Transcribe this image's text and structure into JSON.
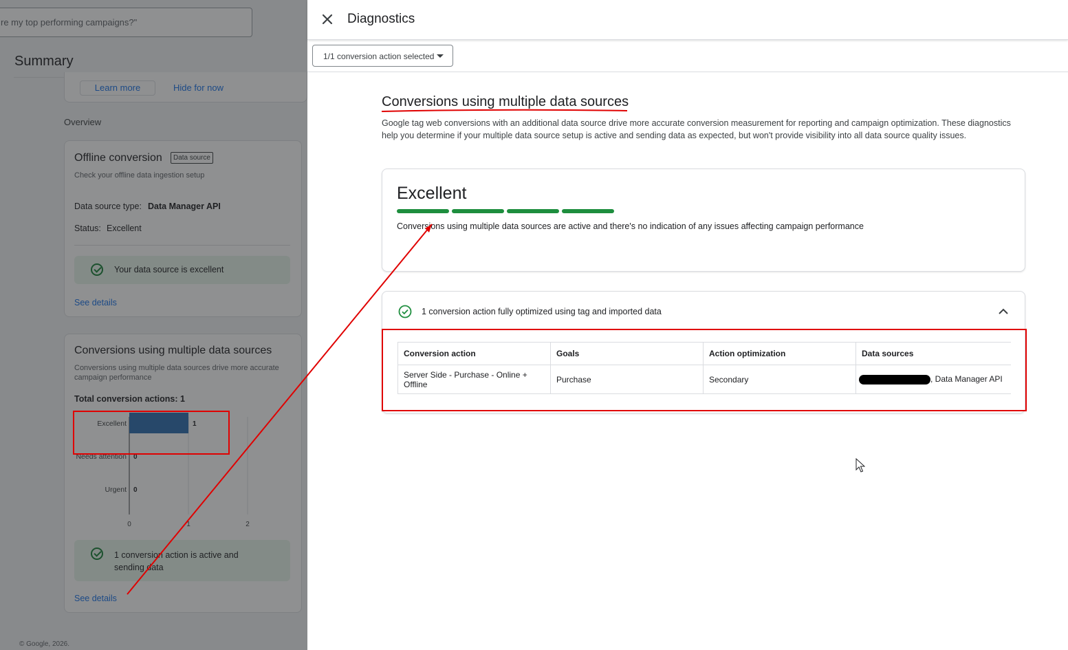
{
  "background": {
    "search_placeholder": "re my top performing campaigns?\"",
    "summary_title": "Summary",
    "learn_more": "Learn more",
    "hide_for_now": "Hide for now",
    "overview_label": "Overview",
    "offline_card": {
      "title": "Offline conversion",
      "chip": "Data source",
      "subtitle": "Check your offline data ingestion setup",
      "type_label": "Data source type:",
      "type_value": "Data Manager API",
      "status_label": "Status:",
      "status_value": "Excellent",
      "banner": "Your data source is excellent",
      "see_details": "See details"
    },
    "multi_card": {
      "title": "Conversions using multiple data sources",
      "subtitle": "Conversions using multiple data sources drive more accurate campaign performance",
      "total_label": "Total conversion actions: 1",
      "banner": "1 conversion action is active and sending data",
      "see_details": "See details"
    },
    "footer": "© Google, 2026."
  },
  "chart_data": {
    "type": "bar",
    "orientation": "horizontal",
    "categories": [
      "Excellent",
      "Needs attention",
      "Urgent"
    ],
    "values": [
      1,
      0,
      0
    ],
    "xticks": [
      "0",
      "1",
      "2"
    ],
    "xlim": [
      0,
      2
    ],
    "bar_color": "#2f6eb0"
  },
  "panel": {
    "title": "Diagnostics",
    "filter_label": "1/1 conversion action selected",
    "section_title": "Conversions using multiple data sources",
    "section_description": "Google tag web conversions with an additional data source drive more accurate conversion measurement for reporting and campaign optimization. These diagnostics help you determine if your multiple data source setup is active and sending data as expected, but won't provide visibility into all data source quality issues.",
    "status": {
      "title": "Excellent",
      "level": "4 of 4",
      "description": "Conversions using multiple data sources are active and there's no indication of any issues affecting campaign performance"
    },
    "expand": {
      "label": "1 conversion action fully optimized using tag and imported data",
      "table": {
        "headers": [
          "Conversion action",
          "Goals",
          "Action optimization",
          "Data sources"
        ],
        "rows": [
          {
            "conversion_action": "Server Side - Purchase - Online + Offline",
            "goals": "Purchase",
            "action_optimization": "Secondary",
            "data_sources": ", Data Manager API"
          }
        ]
      }
    }
  },
  "colors": {
    "accent": "#1a73e8",
    "success": "#1e8e3e",
    "annotation": "#e00000"
  }
}
